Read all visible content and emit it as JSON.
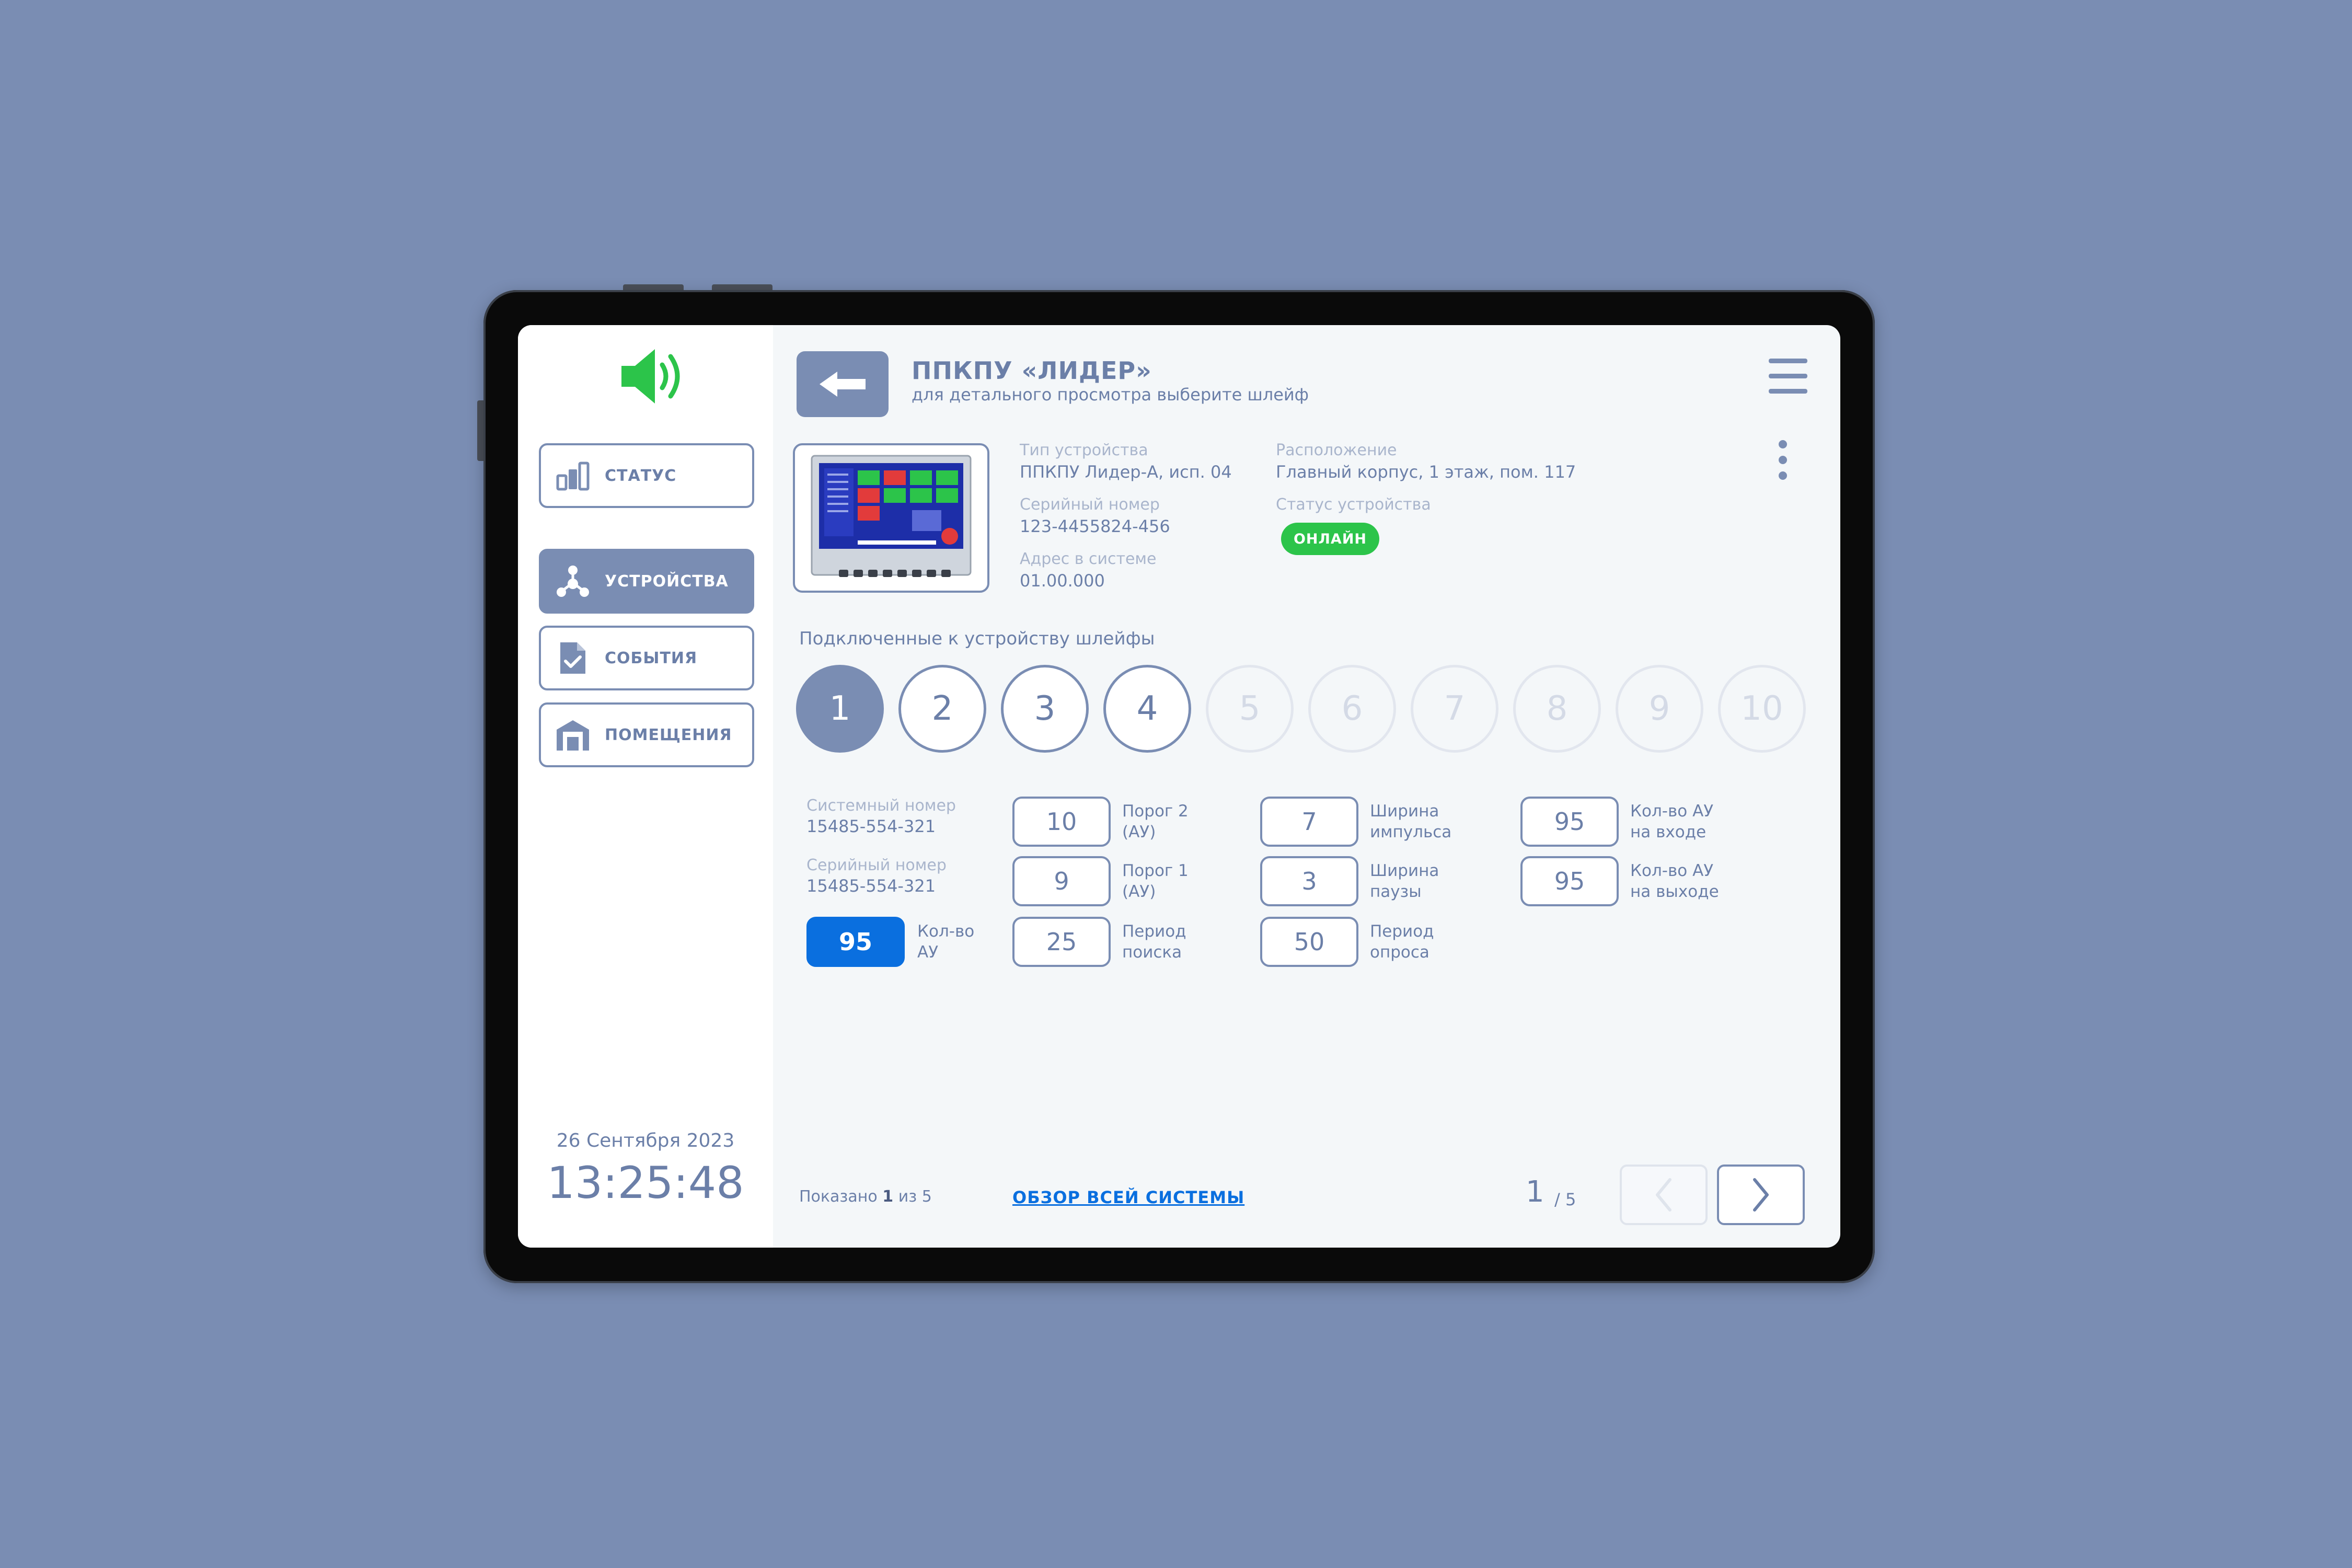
{
  "sidebar": {
    "nav": [
      {
        "label": "СТАТУС",
        "icon": "bar-chart-icon"
      },
      {
        "label": "УСТРОЙСТВА",
        "icon": "devices-network-icon"
      },
      {
        "label": "СОБЫТИЯ",
        "icon": "document-check-icon"
      },
      {
        "label": "ПОМЕЩЕНИЯ",
        "icon": "building-icon"
      }
    ],
    "date": "26 Сентября 2023",
    "time": "13:25:48"
  },
  "header": {
    "title": "ППКПУ «ЛИДЕР»",
    "subtitle": "для детального просмотра выберите шлейф"
  },
  "device": {
    "type_label": "Тип устройства",
    "type_value": "ППКПУ Лидер-А, исп. 04",
    "serial_label": "Серийный номер",
    "serial_value": "123-4455824-456",
    "address_label": "Адрес в системе",
    "address_value": "01.00.000",
    "location_label": "Расположение",
    "location_value": "Главный корпус, 1 этаж, пом. 117",
    "status_label": "Статус устройства",
    "status_value": "ОНЛАЙН",
    "status_color": "#2cc44a"
  },
  "loops": {
    "title": "Подключенные к устройству шлейфы",
    "items": [
      "1",
      "2",
      "3",
      "4",
      "5",
      "6",
      "7",
      "8",
      "9",
      "10"
    ],
    "selected": "1",
    "enabled": [
      "1",
      "2",
      "3",
      "4"
    ]
  },
  "params": {
    "system_number_label": "Системный номер",
    "system_number_value": "15485-554-321",
    "serial_number_label": "Серийный номер",
    "serial_number_value": "15485-554-321",
    "au_count": {
      "value": "95",
      "caption1": "Кол-во",
      "caption2": "АУ"
    },
    "threshold2": {
      "value": "10",
      "caption1": "Порог 2",
      "caption2": "(АУ)"
    },
    "threshold1": {
      "value": "9",
      "caption1": "Порог 1",
      "caption2": "(АУ)"
    },
    "search_period": {
      "value": "25",
      "caption1": "Период",
      "caption2": "поиска"
    },
    "pulse_width": {
      "value": "7",
      "caption1": "Ширина",
      "caption2": "импульса"
    },
    "pause_width": {
      "value": "3",
      "caption1": "Ширина",
      "caption2": "паузы"
    },
    "poll_period": {
      "value": "50",
      "caption1": "Период",
      "caption2": "опроса"
    },
    "au_in": {
      "value": "95",
      "caption1": "Кол-во АУ",
      "caption2": "на входе"
    },
    "au_out": {
      "value": "95",
      "caption1": "Кол-во АУ",
      "caption2": "на выходе"
    }
  },
  "footer": {
    "shown_prefix": "Показано",
    "shown_current": "1",
    "shown_suffix": "из 5",
    "overview_link": "ОБЗОР ВСЕЙ СИСТЕМЫ",
    "page_current": "1",
    "page_total": "/ 5"
  },
  "colors": {
    "accent": "#7a8db3",
    "primary_blue": "#0a6fdf",
    "speaker_green": "#2cc44a"
  }
}
